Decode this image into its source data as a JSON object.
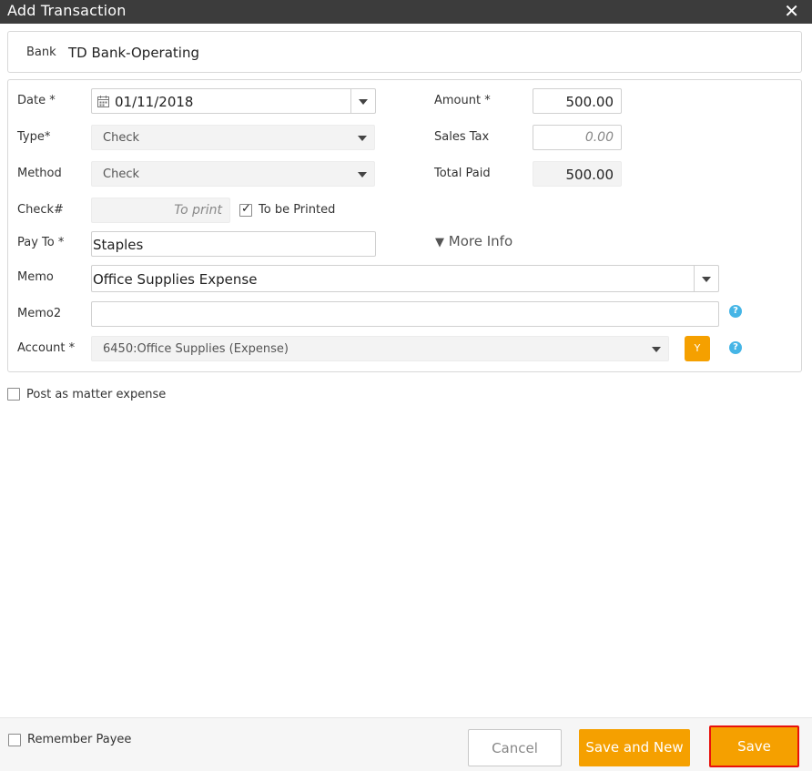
{
  "window": {
    "title": "Add Transaction",
    "close_glyph": "✕"
  },
  "bank": {
    "label": "Bank",
    "value": "TD Bank-Operating"
  },
  "form": {
    "date": {
      "label": "Date *",
      "value": "01/11/2018",
      "icon": "calendar-icon"
    },
    "type": {
      "label": "Type*",
      "value": "Check"
    },
    "method": {
      "label": "Method",
      "value": "Check"
    },
    "check_number": {
      "label": "Check#",
      "placeholder": "To print"
    },
    "to_be_printed": {
      "label": "To be Printed",
      "checked": true
    },
    "pay_to": {
      "label": "Pay To *",
      "value": "Staples"
    },
    "memo": {
      "label": "Memo",
      "value": "Office Supplies Expense"
    },
    "memo2": {
      "label": "Memo2",
      "value": ""
    },
    "account": {
      "label": "Account *",
      "value": "6450:Office Supplies (Expense)",
      "y_button": "Y"
    },
    "amount": {
      "label": "Amount *",
      "value": "500.00"
    },
    "sales_tax": {
      "label": "Sales Tax",
      "placeholder": "0.00"
    },
    "total_paid": {
      "label": "Total Paid",
      "value": "500.00"
    },
    "more_info": {
      "label": "More Info",
      "glyph": "▼"
    },
    "help_glyph": "?"
  },
  "matter_expense": {
    "label": "Post as matter expense",
    "checked": false
  },
  "footer": {
    "remember_payee": {
      "label": "Remember Payee",
      "checked": false
    },
    "cancel_label": "Cancel",
    "save_new_label": "Save and New",
    "save_label": "Save"
  },
  "colors": {
    "accent": "#f5a000",
    "titlebar": "#3c3c3c",
    "help": "#45b5e6",
    "highlight": "#e8120c"
  }
}
